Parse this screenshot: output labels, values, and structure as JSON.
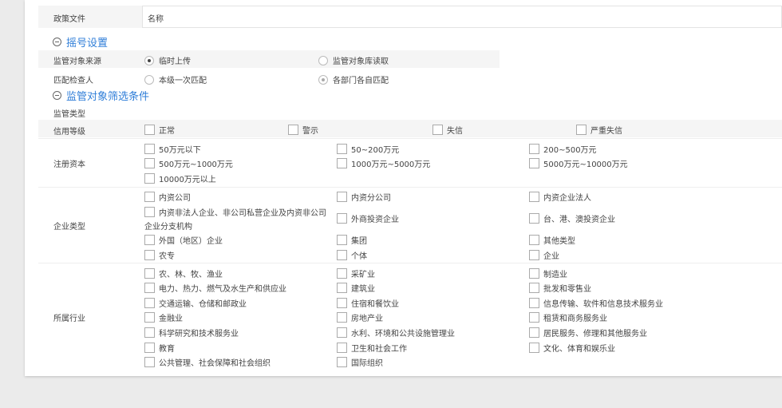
{
  "policy": {
    "label": "政策文件",
    "name": "名称"
  },
  "sections": {
    "shake": "摇号设置",
    "filter": "监管对象筛选条件"
  },
  "source": {
    "label": "监管对象来源",
    "options": [
      "临时上传",
      "监管对象库读取"
    ]
  },
  "checker": {
    "label": "匹配检查人",
    "options": [
      "本级一次匹配",
      "各部门各自匹配"
    ]
  },
  "supervision_type": {
    "label": "监管类型"
  },
  "credit": {
    "label": "信用等级",
    "options": [
      "正常",
      "警示",
      "失信",
      "严重失信"
    ]
  },
  "capital": {
    "label": "注册资本",
    "options": [
      "50万元以下",
      "50~200万元",
      "200~500万元",
      "500万元~1000万元",
      "1000万元~5000万元",
      "5000万元~10000万元",
      "10000万元以上"
    ]
  },
  "enterprise": {
    "label": "企业类型",
    "options": [
      "内资公司",
      "内资分公司",
      "内资企业法人",
      "内资非法人企业、非公司私营企业及内资非公司",
      "外商投资企业",
      "台、港、澳投资企业",
      "外国（地区）企业",
      "集团",
      "其他类型",
      "农专",
      "个体",
      "企业"
    ],
    "wrap_tail": "企业分支机构"
  },
  "industry": {
    "label": "所属行业",
    "options": [
      "农、林、牧、渔业",
      "采矿业",
      "制造业",
      "电力、热力、燃气及水生产和供应业",
      "建筑业",
      "批发和零售业",
      "交通运输、仓储和邮政业",
      "住宿和餐饮业",
      "信息传输、软件和信息技术服务业",
      "金融业",
      "房地产业",
      "租赁和商务服务业",
      "科学研究和技术服务业",
      "水利、环境和公共设施管理业",
      "居民服务、修理和其他服务业",
      "教育",
      "卫生和社会工作",
      "文化、体育和娱乐业",
      "公共管理、社会保障和社会组织",
      "国际组织"
    ]
  }
}
